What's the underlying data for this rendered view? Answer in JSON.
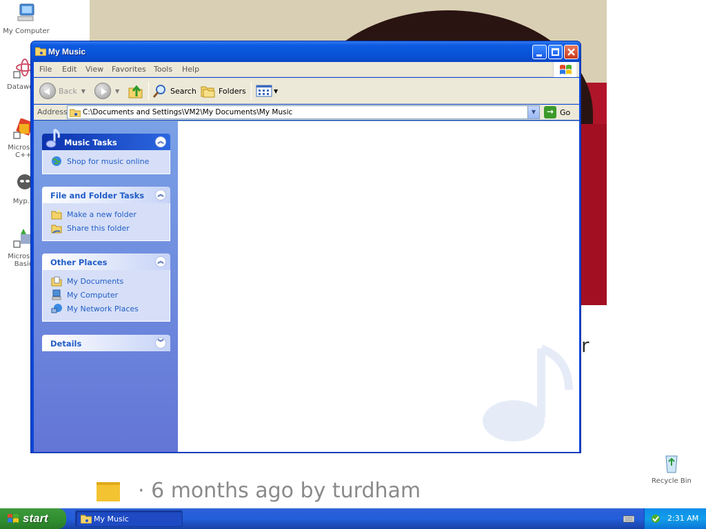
{
  "desktop": {
    "icons": [
      {
        "label": "My Computer"
      },
      {
        "label": "Datawe..."
      },
      {
        "label": "Microsoft C++"
      },
      {
        "label": "Myp..."
      },
      {
        "label": "Microsoft Basic"
      },
      {
        "label": "Recycle Bin"
      }
    ],
    "background_caption": "· 6 months ago by turdham"
  },
  "window": {
    "title": "My Music",
    "menu": [
      "File",
      "Edit",
      "View",
      "Favorites",
      "Tools",
      "Help"
    ],
    "toolbar": {
      "back": "Back",
      "search": "Search",
      "folders": "Folders"
    },
    "address": {
      "label": "Address",
      "path": "C:\\Documents and Settings\\VM2\\My Documents\\My Music",
      "go": "Go"
    },
    "task_panels": [
      {
        "title": "Music Tasks",
        "items": [
          "Shop for music online"
        ]
      },
      {
        "title": "File and Folder Tasks",
        "items": [
          "Make a new folder",
          "Share this folder"
        ]
      },
      {
        "title": "Other Places",
        "items": [
          "My Documents",
          "My Computer",
          "My Network Places"
        ]
      },
      {
        "title": "Details",
        "items": []
      }
    ]
  },
  "taskbar": {
    "start": "start",
    "task_button": "My Music",
    "clock": "2:31 AM"
  },
  "colors": {
    "window_frame": "#0a46d6",
    "task_pane": "#7aa1e6",
    "link": "#215dc6",
    "taskbar": "#245edb",
    "start_green": "#2f8d2f"
  }
}
